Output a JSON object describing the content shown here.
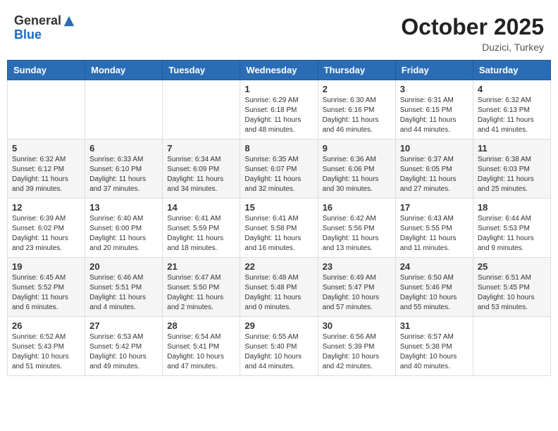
{
  "header": {
    "logo_line1": "General",
    "logo_line2": "Blue",
    "month": "October 2025",
    "location": "Duzici, Turkey"
  },
  "days_of_week": [
    "Sunday",
    "Monday",
    "Tuesday",
    "Wednesday",
    "Thursday",
    "Friday",
    "Saturday"
  ],
  "weeks": [
    [
      {
        "day": "",
        "info": ""
      },
      {
        "day": "",
        "info": ""
      },
      {
        "day": "",
        "info": ""
      },
      {
        "day": "1",
        "info": "Sunrise: 6:29 AM\nSunset: 6:18 PM\nDaylight: 11 hours\nand 48 minutes."
      },
      {
        "day": "2",
        "info": "Sunrise: 6:30 AM\nSunset: 6:16 PM\nDaylight: 11 hours\nand 46 minutes."
      },
      {
        "day": "3",
        "info": "Sunrise: 6:31 AM\nSunset: 6:15 PM\nDaylight: 11 hours\nand 44 minutes."
      },
      {
        "day": "4",
        "info": "Sunrise: 6:32 AM\nSunset: 6:13 PM\nDaylight: 11 hours\nand 41 minutes."
      }
    ],
    [
      {
        "day": "5",
        "info": "Sunrise: 6:32 AM\nSunset: 6:12 PM\nDaylight: 11 hours\nand 39 minutes."
      },
      {
        "day": "6",
        "info": "Sunrise: 6:33 AM\nSunset: 6:10 PM\nDaylight: 11 hours\nand 37 minutes."
      },
      {
        "day": "7",
        "info": "Sunrise: 6:34 AM\nSunset: 6:09 PM\nDaylight: 11 hours\nand 34 minutes."
      },
      {
        "day": "8",
        "info": "Sunrise: 6:35 AM\nSunset: 6:07 PM\nDaylight: 11 hours\nand 32 minutes."
      },
      {
        "day": "9",
        "info": "Sunrise: 6:36 AM\nSunset: 6:06 PM\nDaylight: 11 hours\nand 30 minutes."
      },
      {
        "day": "10",
        "info": "Sunrise: 6:37 AM\nSunset: 6:05 PM\nDaylight: 11 hours\nand 27 minutes."
      },
      {
        "day": "11",
        "info": "Sunrise: 6:38 AM\nSunset: 6:03 PM\nDaylight: 11 hours\nand 25 minutes."
      }
    ],
    [
      {
        "day": "12",
        "info": "Sunrise: 6:39 AM\nSunset: 6:02 PM\nDaylight: 11 hours\nand 23 minutes."
      },
      {
        "day": "13",
        "info": "Sunrise: 6:40 AM\nSunset: 6:00 PM\nDaylight: 11 hours\nand 20 minutes."
      },
      {
        "day": "14",
        "info": "Sunrise: 6:41 AM\nSunset: 5:59 PM\nDaylight: 11 hours\nand 18 minutes."
      },
      {
        "day": "15",
        "info": "Sunrise: 6:41 AM\nSunset: 5:58 PM\nDaylight: 11 hours\nand 16 minutes."
      },
      {
        "day": "16",
        "info": "Sunrise: 6:42 AM\nSunset: 5:56 PM\nDaylight: 11 hours\nand 13 minutes."
      },
      {
        "day": "17",
        "info": "Sunrise: 6:43 AM\nSunset: 5:55 PM\nDaylight: 11 hours\nand 11 minutes."
      },
      {
        "day": "18",
        "info": "Sunrise: 6:44 AM\nSunset: 5:53 PM\nDaylight: 11 hours\nand 9 minutes."
      }
    ],
    [
      {
        "day": "19",
        "info": "Sunrise: 6:45 AM\nSunset: 5:52 PM\nDaylight: 11 hours\nand 6 minutes."
      },
      {
        "day": "20",
        "info": "Sunrise: 6:46 AM\nSunset: 5:51 PM\nDaylight: 11 hours\nand 4 minutes."
      },
      {
        "day": "21",
        "info": "Sunrise: 6:47 AM\nSunset: 5:50 PM\nDaylight: 11 hours\nand 2 minutes."
      },
      {
        "day": "22",
        "info": "Sunrise: 6:48 AM\nSunset: 5:48 PM\nDaylight: 11 hours\nand 0 minutes."
      },
      {
        "day": "23",
        "info": "Sunrise: 6:49 AM\nSunset: 5:47 PM\nDaylight: 10 hours\nand 57 minutes."
      },
      {
        "day": "24",
        "info": "Sunrise: 6:50 AM\nSunset: 5:46 PM\nDaylight: 10 hours\nand 55 minutes."
      },
      {
        "day": "25",
        "info": "Sunrise: 6:51 AM\nSunset: 5:45 PM\nDaylight: 10 hours\nand 53 minutes."
      }
    ],
    [
      {
        "day": "26",
        "info": "Sunrise: 6:52 AM\nSunset: 5:43 PM\nDaylight: 10 hours\nand 51 minutes."
      },
      {
        "day": "27",
        "info": "Sunrise: 6:53 AM\nSunset: 5:42 PM\nDaylight: 10 hours\nand 49 minutes."
      },
      {
        "day": "28",
        "info": "Sunrise: 6:54 AM\nSunset: 5:41 PM\nDaylight: 10 hours\nand 47 minutes."
      },
      {
        "day": "29",
        "info": "Sunrise: 6:55 AM\nSunset: 5:40 PM\nDaylight: 10 hours\nand 44 minutes."
      },
      {
        "day": "30",
        "info": "Sunrise: 6:56 AM\nSunset: 5:39 PM\nDaylight: 10 hours\nand 42 minutes."
      },
      {
        "day": "31",
        "info": "Sunrise: 6:57 AM\nSunset: 5:38 PM\nDaylight: 10 hours\nand 40 minutes."
      },
      {
        "day": "",
        "info": ""
      }
    ]
  ]
}
